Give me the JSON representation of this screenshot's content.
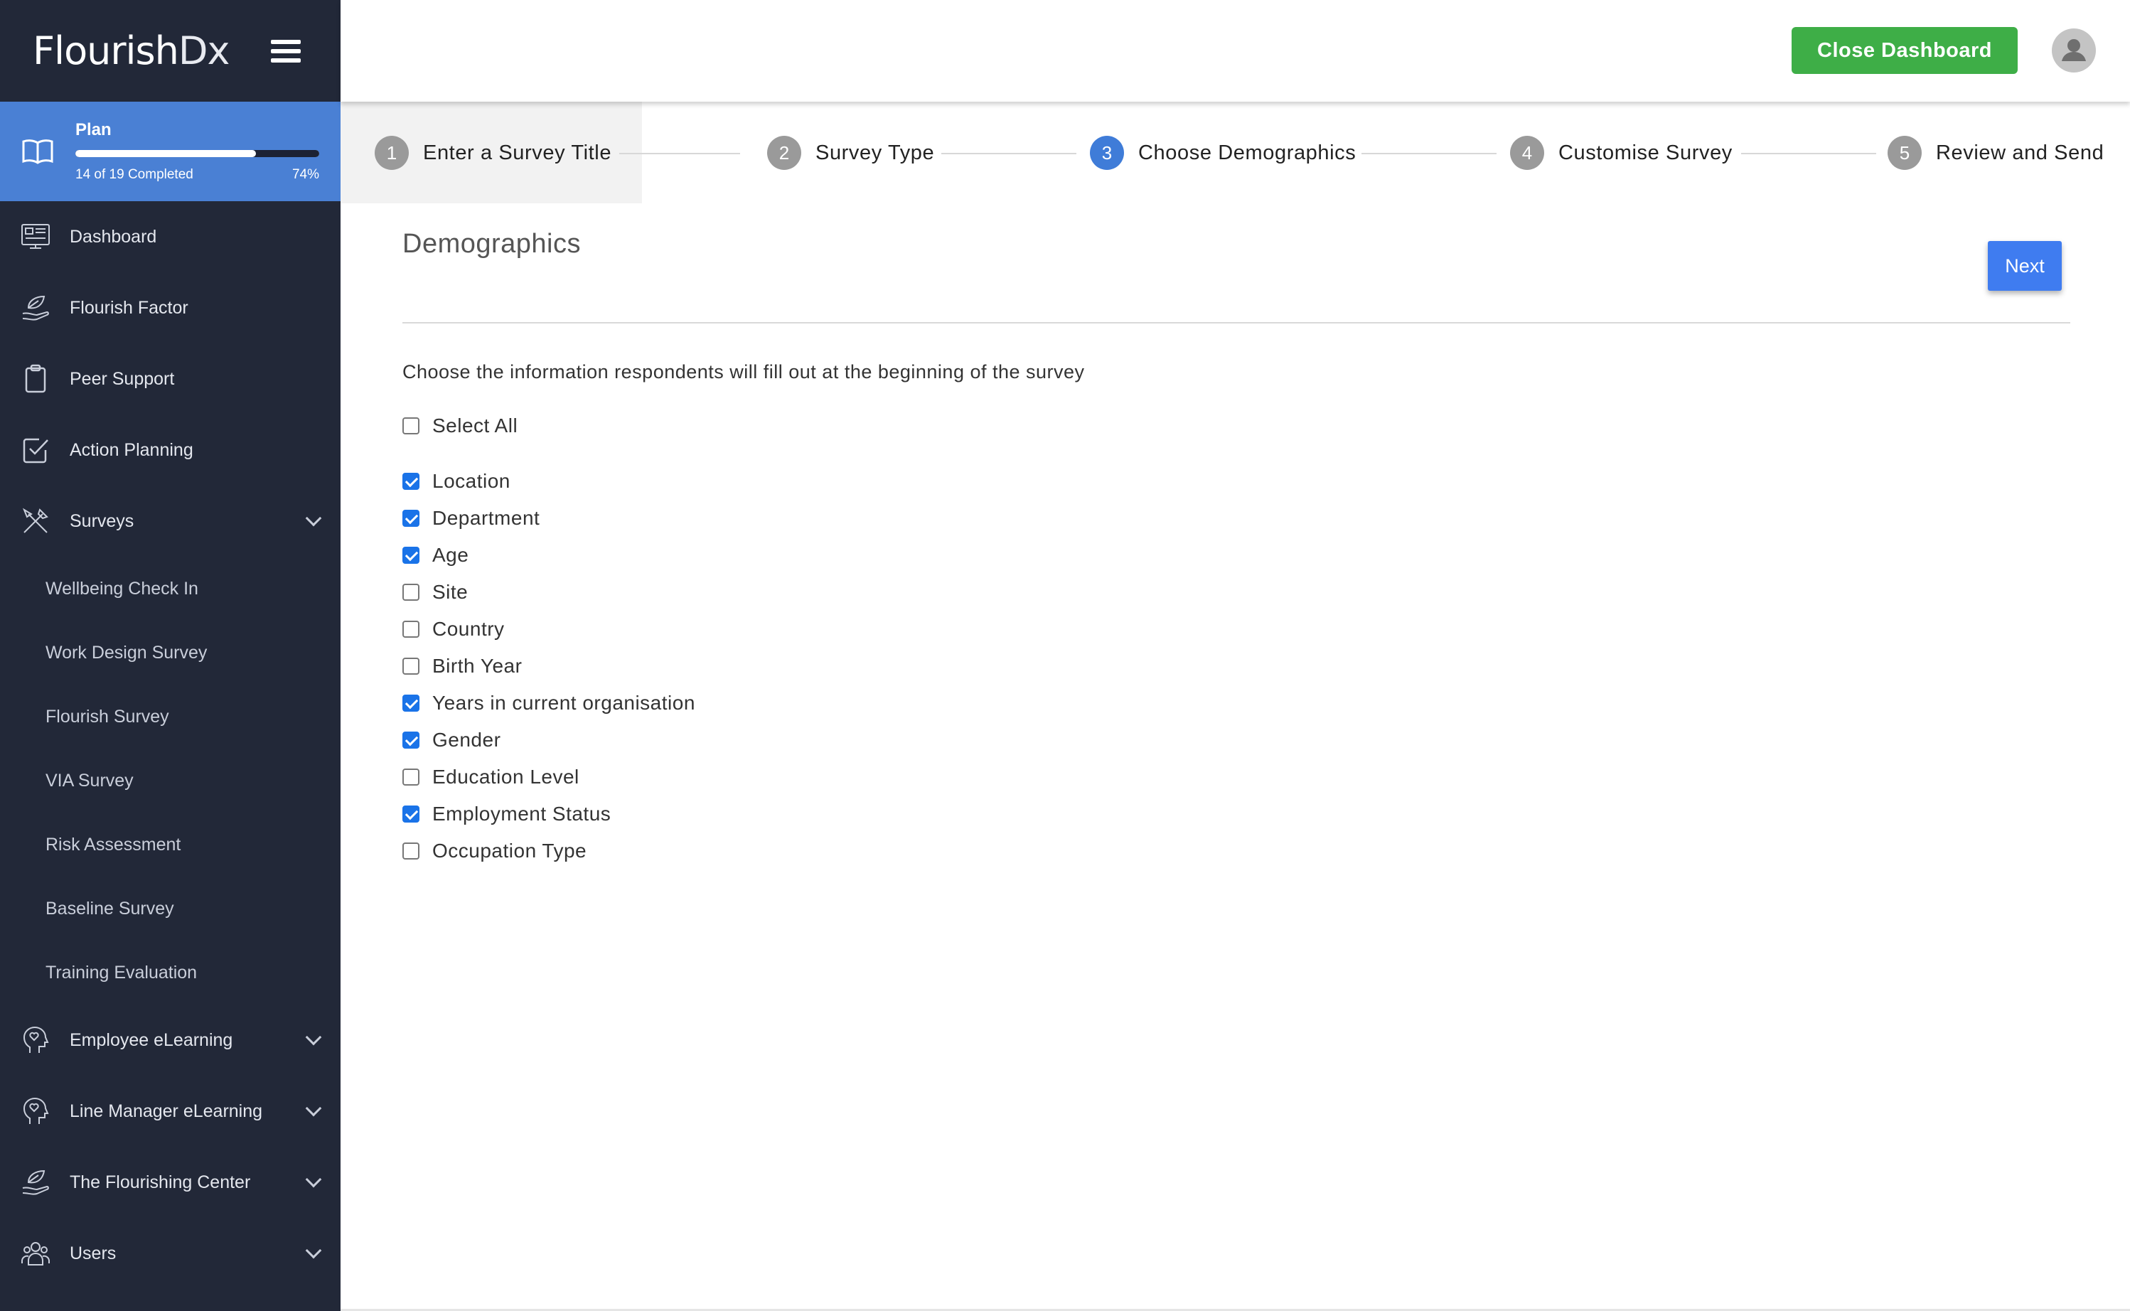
{
  "brand": {
    "logo_bold": "Flourish",
    "logo_light": "Dx"
  },
  "plan": {
    "title": "Plan",
    "completed_text": "14 of 19 Completed",
    "percent_text": "74%",
    "progress": 0.74
  },
  "nav": {
    "dashboard": "Dashboard",
    "flourish_factor": "Flourish Factor",
    "peer_support": "Peer Support",
    "action_planning": "Action Planning",
    "surveys": "Surveys",
    "survey_items": [
      "Wellbeing Check In",
      "Work Design Survey",
      "Flourish Survey",
      "VIA Survey",
      "Risk Assessment",
      "Baseline Survey",
      "Training Evaluation"
    ],
    "employee_elearning": "Employee eLearning",
    "line_manager_elearning": "Line Manager eLearning",
    "flourishing_center": "The Flourishing Center",
    "users": "Users"
  },
  "header": {
    "close_label": "Close Dashboard"
  },
  "steps": [
    {
      "num": "1",
      "label": "Enter a Survey Title"
    },
    {
      "num": "2",
      "label": "Survey Type"
    },
    {
      "num": "3",
      "label": "Choose Demographics"
    },
    {
      "num": "4",
      "label": "Customise Survey"
    },
    {
      "num": "5",
      "label": "Review and Send"
    }
  ],
  "main": {
    "title": "Demographics",
    "next_label": "Next",
    "instructions": "Choose the information respondents will fill out at the beginning of the survey",
    "select_all": "Select All",
    "options": [
      {
        "label": "Location",
        "checked": true
      },
      {
        "label": "Department",
        "checked": true
      },
      {
        "label": "Age",
        "checked": true
      },
      {
        "label": "Site",
        "checked": false
      },
      {
        "label": "Country",
        "checked": false
      },
      {
        "label": "Birth Year",
        "checked": false
      },
      {
        "label": "Years in current organisation",
        "checked": true
      },
      {
        "label": "Gender",
        "checked": true
      },
      {
        "label": "Education Level",
        "checked": false
      },
      {
        "label": "Employment Status",
        "checked": true
      },
      {
        "label": "Occupation Type",
        "checked": false
      }
    ]
  }
}
